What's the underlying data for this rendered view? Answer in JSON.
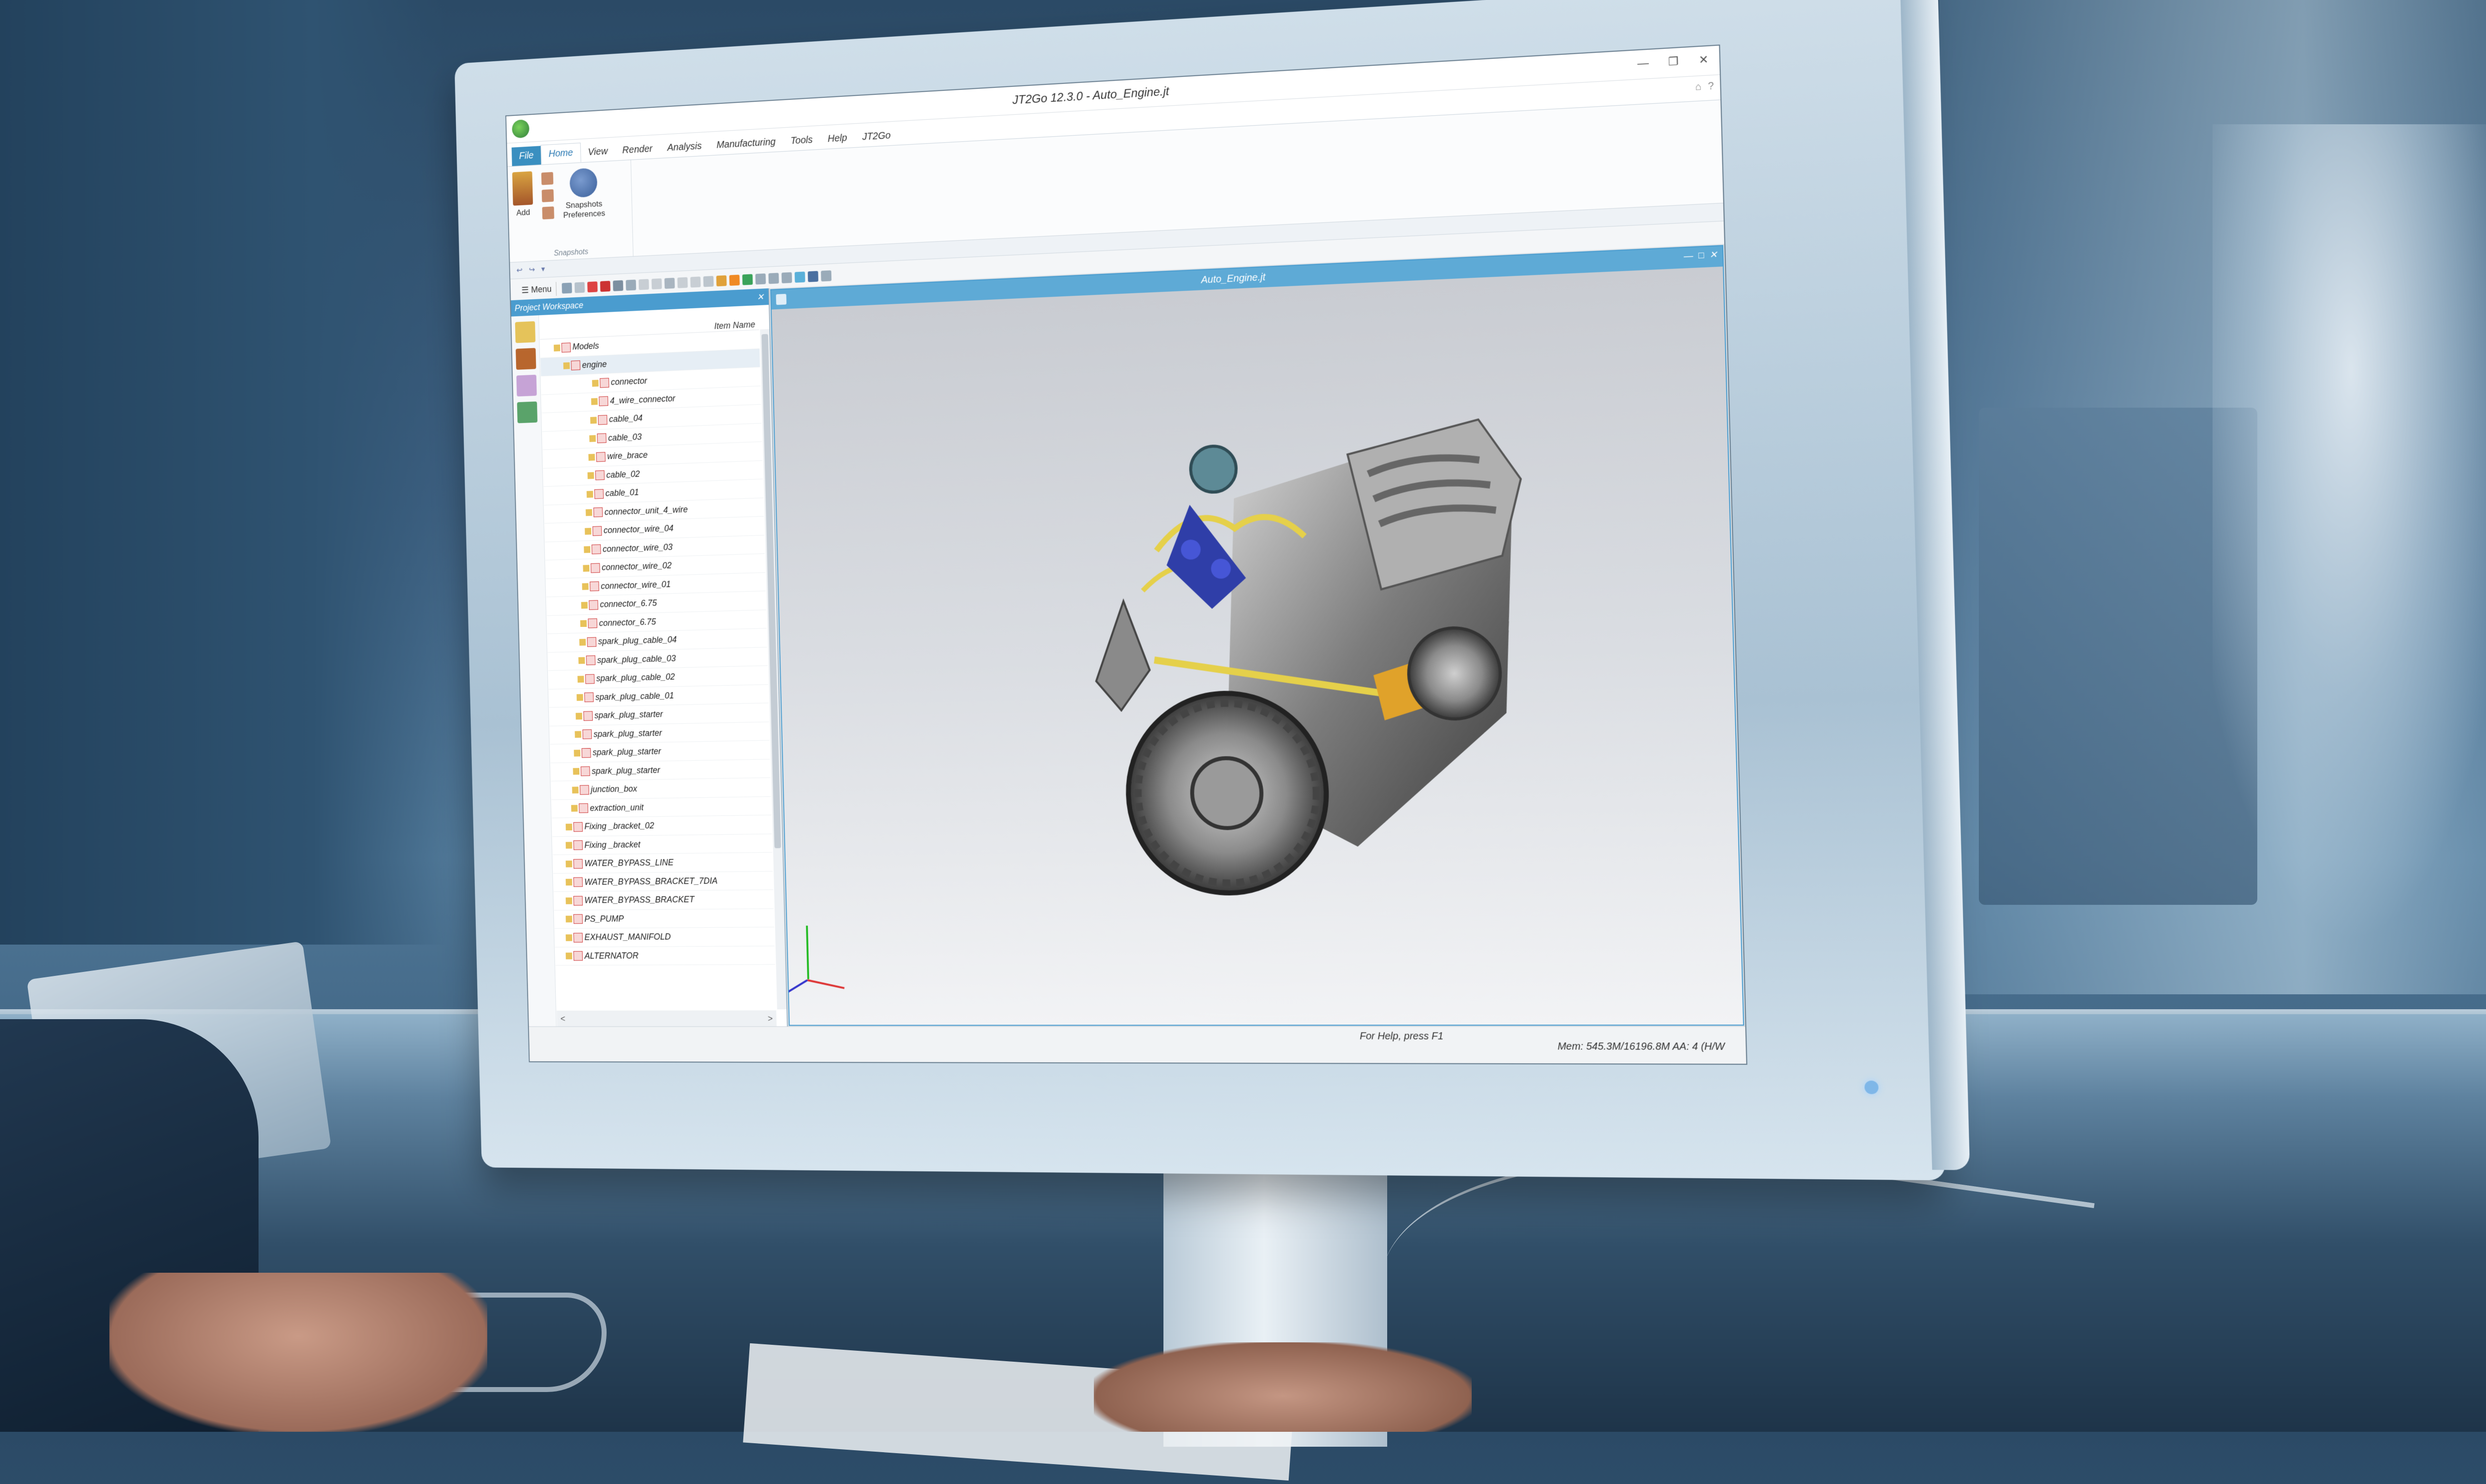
{
  "window": {
    "title": "JT2Go 12.3.0 - Auto_Engine.jt",
    "controls": [
      "—",
      "❐",
      "✕"
    ]
  },
  "ribbon": {
    "tabs": [
      "File",
      "Home",
      "View",
      "Render",
      "Analysis",
      "Manufacturing",
      "Tools",
      "Help",
      "JT2Go"
    ],
    "active_tab": "Home",
    "right_icons": [
      "⌂",
      "?"
    ],
    "group": {
      "label": "Snapshots",
      "buttons": {
        "add": "Add",
        "snapshots_line1": "Snapshots",
        "snapshots_line2": "Preferences"
      }
    }
  },
  "quick_access": [
    "↩",
    "↪",
    "▾"
  ],
  "toolbar": {
    "menu_label": "☰ Menu"
  },
  "project_workspace": {
    "title": "Project Workspace",
    "close": "✕",
    "column_header": "Item Name",
    "items": [
      "Models",
      "engine",
      "connector",
      "4_wire_connector",
      "cable_04",
      "cable_03",
      "wire_brace",
      "cable_02",
      "cable_01",
      "connector_unit_4_wire",
      "connector_wire_04",
      "connector_wire_03",
      "connector_wire_02",
      "connector_wire_01",
      "connector_6.75",
      "connector_6.75",
      "spark_plug_cable_04",
      "spark_plug_cable_03",
      "spark_plug_cable_02",
      "spark_plug_cable_01",
      "spark_plug_starter",
      "spark_plug_starter",
      "spark_plug_starter",
      "spark_plug_starter",
      "junction_box",
      "extraction_unit",
      "Fixing _bracket_02",
      "Fixing _bracket",
      "WATER_BYPASS_LINE",
      "WATER_BYPASS_BRACKET_7DIA",
      "WATER_BYPASS_BRACKET",
      "PS_PUMP",
      "EXHAUST_MANIFOLD",
      "ALTERNATOR"
    ],
    "scroll_left": "<",
    "scroll_right": ">"
  },
  "viewport": {
    "title": "Auto_Engine.jt",
    "controls": [
      "—",
      "□",
      "✕"
    ]
  },
  "status": {
    "help": "For Help, press F1",
    "memory": "Mem: 545.3M/16196.8M  AA: 4 (H/W"
  }
}
